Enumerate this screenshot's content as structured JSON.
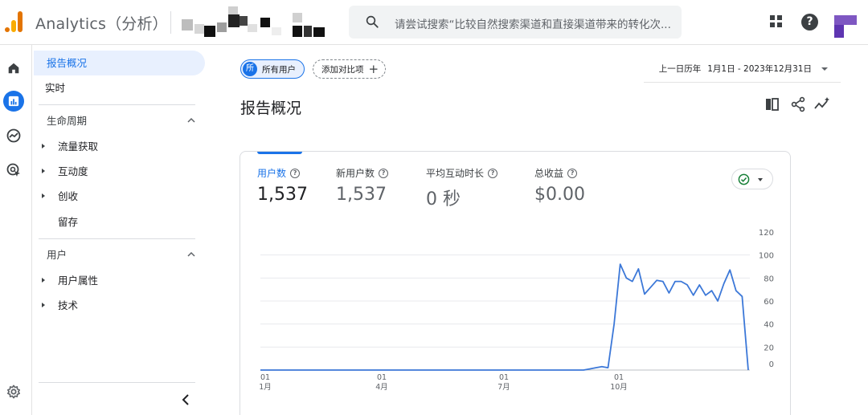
{
  "app": {
    "title": "Analytics（分析）"
  },
  "search": {
    "placeholder": "请尝试搜索“比较自然搜索渠道和直接渠道带来的转化次..."
  },
  "sidebar": {
    "items": [
      {
        "label": "报告概况"
      },
      {
        "label": "实时"
      }
    ],
    "lifecycle": {
      "title": "生命周期",
      "items": [
        {
          "label": "流量获取"
        },
        {
          "label": "互动度"
        },
        {
          "label": "创收"
        },
        {
          "label": "留存"
        }
      ]
    },
    "user": {
      "title": "用户",
      "items": [
        {
          "label": "用户属性"
        },
        {
          "label": "技术"
        }
      ]
    }
  },
  "comparison": {
    "badge": "所",
    "all_users": "所有用户",
    "add": "添加对比项"
  },
  "date": {
    "compare": "上一日历年",
    "range": "1月1日 - 2023年12月31日"
  },
  "page": {
    "title": "报告概况"
  },
  "metrics": [
    {
      "label": "用户数",
      "value": "1,537"
    },
    {
      "label": "新用户数",
      "value": "1,537"
    },
    {
      "label": "平均互动时长",
      "value": "0 秒"
    },
    {
      "label": "总收益",
      "value": "$0.00"
    }
  ],
  "colors": {
    "accent": "#1a73e8",
    "line": "#3c78d8",
    "success": "#188038"
  },
  "chart_data": {
    "type": "line",
    "y_ticks": [
      "120",
      "100",
      "80",
      "60",
      "40",
      "20",
      "0"
    ],
    "x_ticks": [
      {
        "top": "01",
        "bottom": "1月"
      },
      {
        "top": "01",
        "bottom": "4月"
      },
      {
        "top": "01",
        "bottom": "7月"
      },
      {
        "top": "01",
        "bottom": "10月"
      }
    ],
    "ylim": [
      0,
      120
    ],
    "grid": true,
    "series": [
      {
        "values": [
          0,
          0,
          0,
          0,
          0,
          0,
          0,
          0,
          0,
          0,
          0,
          0,
          0,
          0,
          0,
          0,
          0,
          0,
          0,
          0,
          0,
          0,
          0,
          0,
          0,
          0,
          0,
          0,
          0,
          0,
          0,
          0,
          0,
          0,
          0,
          0,
          0,
          0,
          0,
          0,
          0,
          0,
          0,
          0,
          0,
          0,
          0,
          0,
          0,
          0,
          0,
          0,
          0,
          0,
          1,
          2,
          3,
          2,
          40,
          92,
          80,
          77,
          88,
          66,
          72,
          78,
          77,
          67,
          77,
          77,
          74,
          65,
          74,
          65,
          69,
          60,
          75,
          87,
          69,
          64,
          0
        ]
      }
    ]
  }
}
